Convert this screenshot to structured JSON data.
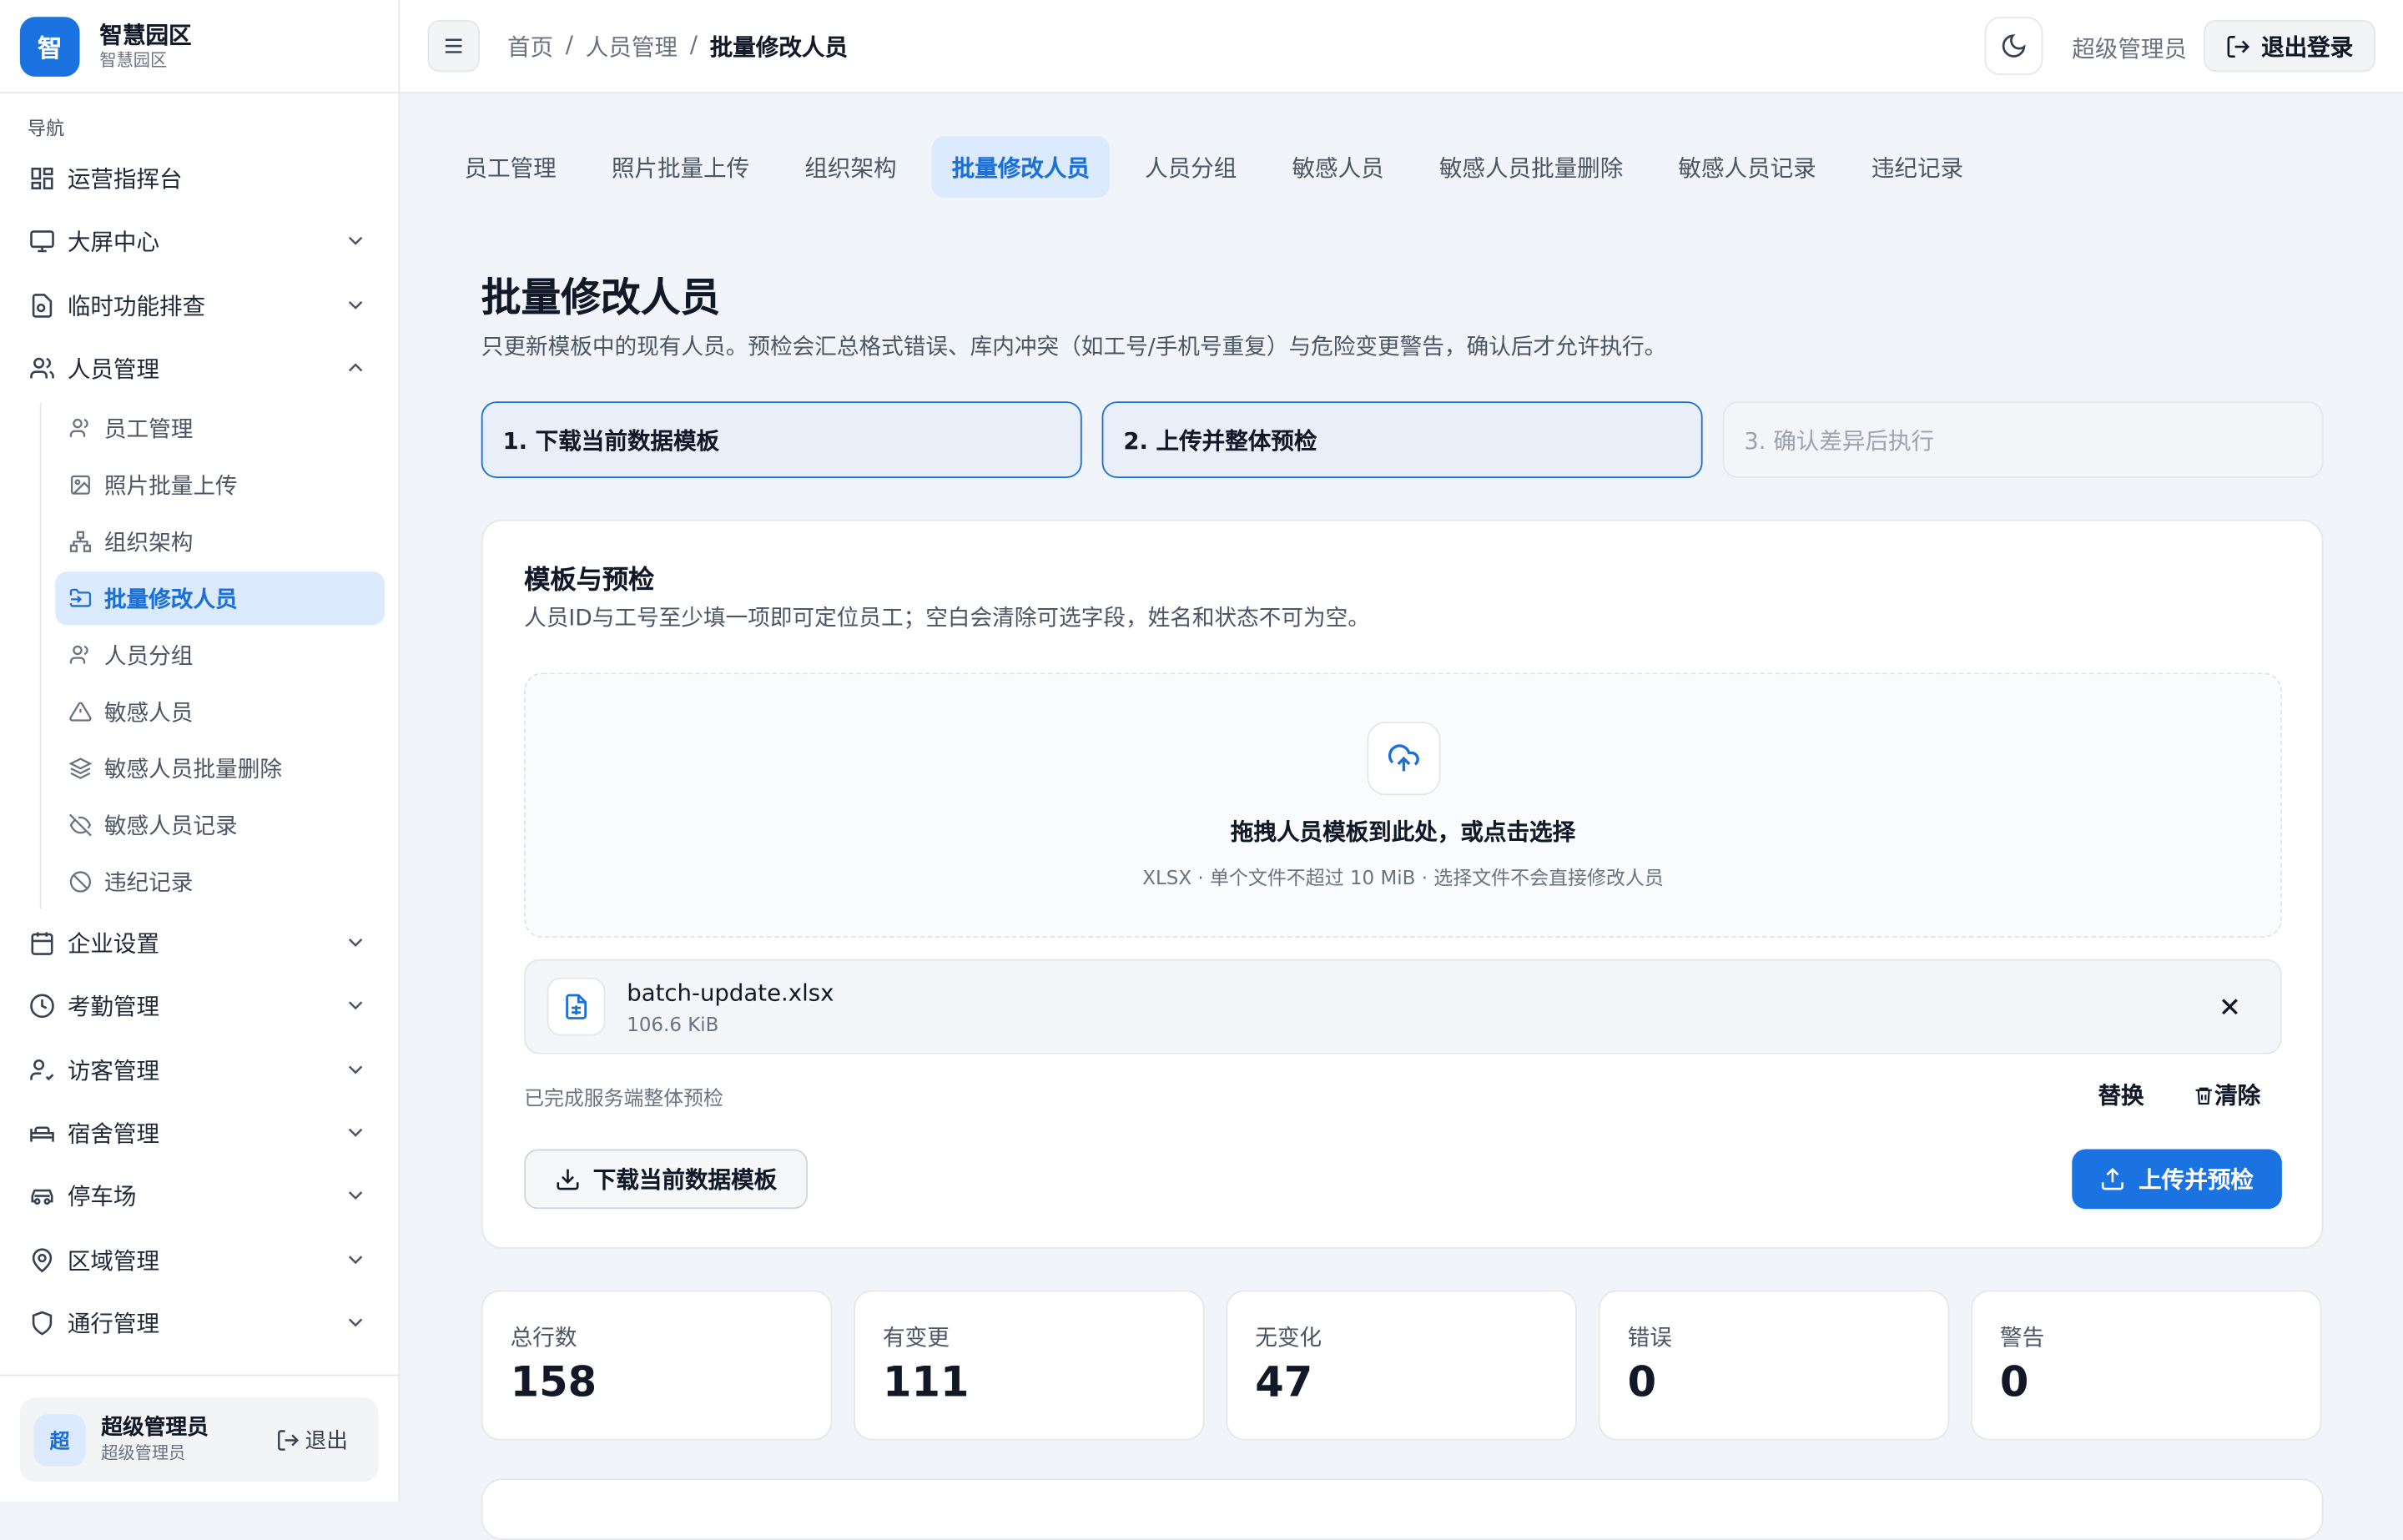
{
  "brand": {
    "logo": "智",
    "title": "智慧园区",
    "subtitle": "智慧园区"
  },
  "nav": {
    "caption": "导航",
    "items": [
      {
        "label": "运营指挥台",
        "icon": "dashboard-icon"
      },
      {
        "label": "大屏中心",
        "icon": "monitor-icon"
      },
      {
        "label": "临时功能排查",
        "icon": "file-search-icon"
      },
      {
        "label": "人员管理",
        "icon": "users-icon"
      },
      {
        "label": "企业设置",
        "icon": "calendar-icon"
      },
      {
        "label": "考勤管理",
        "icon": "clock-icon"
      },
      {
        "label": "访客管理",
        "icon": "user-check-icon"
      },
      {
        "label": "宿舍管理",
        "icon": "bed-icon"
      },
      {
        "label": "停车场",
        "icon": "car-icon"
      },
      {
        "label": "区域管理",
        "icon": "map-pin-icon"
      },
      {
        "label": "通行管理",
        "icon": "shield-icon"
      }
    ],
    "sub_items": [
      {
        "label": "员工管理",
        "icon": "users-icon"
      },
      {
        "label": "照片批量上传",
        "icon": "image-icon"
      },
      {
        "label": "组织架构",
        "icon": "org-chart-icon"
      },
      {
        "label": "批量修改人员",
        "icon": "folder-input-icon"
      },
      {
        "label": "人员分组",
        "icon": "users-icon"
      },
      {
        "label": "敏感人员",
        "icon": "alert-triangle-icon"
      },
      {
        "label": "敏感人员批量删除",
        "icon": "layers-icon"
      },
      {
        "label": "敏感人员记录",
        "icon": "eye-off-icon"
      },
      {
        "label": "违纪记录",
        "icon": "ban-icon"
      }
    ]
  },
  "sidebar_user": {
    "avatar": "超",
    "name": "超级管理员",
    "role": "超级管理员",
    "logout": "退出"
  },
  "header": {
    "breadcrumb": [
      "首页",
      "人员管理",
      "批量修改人员"
    ],
    "separator": "/",
    "user": "超级管理员",
    "logout": "退出登录"
  },
  "tabs": [
    "员工管理",
    "照片批量上传",
    "组织架构",
    "批量修改人员",
    "人员分组",
    "敏感人员",
    "敏感人员批量删除",
    "敏感人员记录",
    "违纪记录"
  ],
  "page": {
    "title": "批量修改人员",
    "description": "只更新模板中的现有人员。预检会汇总格式错误、库内冲突（如工号/手机号重复）与危险变更警告，确认后才允许执行。"
  },
  "steps": [
    "1. 下载当前数据模板",
    "2. 上传并整体预检",
    "3. 确认差异后执行"
  ],
  "template_card": {
    "title": "模板与预检",
    "description": "人员ID与工号至少填一项即可定位员工；空白会清除可选字段，姓名和状态不可为空。",
    "dropzone_title": "拖拽人员模板到此处，或点击选择",
    "dropzone_hint": "XLSX · 单个文件不超过 10 MiB · 选择文件不会直接修改人员",
    "file_name": "batch-update.xlsx",
    "file_size": "106.6 KiB",
    "status": "已完成服务端整体预检",
    "replace": "替换",
    "clear": "清除",
    "download": "下载当前数据模板",
    "upload": "上传并预检"
  },
  "stats": [
    {
      "label": "总行数",
      "value": "158"
    },
    {
      "label": "有变更",
      "value": "111"
    },
    {
      "label": "无变化",
      "value": "47"
    },
    {
      "label": "错误",
      "value": "0"
    },
    {
      "label": "警告",
      "value": "0"
    }
  ],
  "colors": {
    "accent": "#1a73e0",
    "active_bg": "#dbeafe",
    "page_bg": "#f1f4f8"
  }
}
